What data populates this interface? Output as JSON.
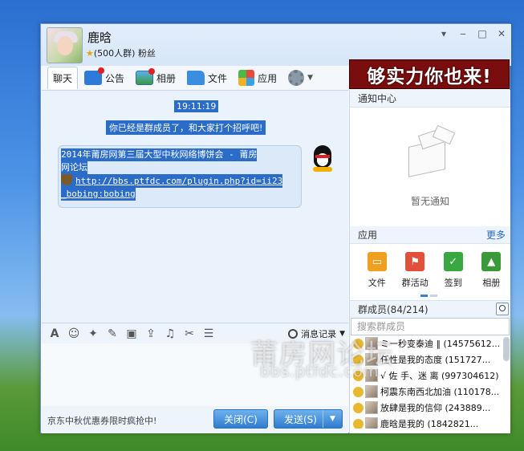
{
  "header": {
    "group_name": "鹿晗",
    "group_sub": "(500人群) 粉丝"
  },
  "tabs": [
    {
      "label": "聊天",
      "icon": "chat-icon"
    },
    {
      "label": "公告",
      "icon": "announcement-icon"
    },
    {
      "label": "相册",
      "icon": "album-icon"
    },
    {
      "label": "文件",
      "icon": "folder-icon"
    },
    {
      "label": "应用",
      "icon": "apps-icon"
    }
  ],
  "ad": {
    "text": "够实力你也来!"
  },
  "chat": {
    "time": "19:11:19",
    "system_message": "你已经是群成员了，和大家打个招呼吧!",
    "message": {
      "line1": "2014年莆房网第三届大型中秋网络博饼会 - 莆房",
      "line2": "网论坛",
      "link1": "http://bbs.ptfdc.com/plugin.php?id=ii23",
      "link2": "_bobing:bobing"
    }
  },
  "toolbar": {
    "history_label": "消息记录"
  },
  "bottom": {
    "promo": "京东中秋优惠券限时疯抢中!",
    "close_label": "关闭(C)",
    "send_label": "发送(S)"
  },
  "notifications": {
    "title": "通知中心",
    "empty": "暂无通知"
  },
  "apps": {
    "title": "应用",
    "more": "更多",
    "items": [
      {
        "label": "文件",
        "icon": "folder-icon"
      },
      {
        "label": "群活动",
        "icon": "flag-icon"
      },
      {
        "label": "签到",
        "icon": "checkin-icon"
      },
      {
        "label": "相册",
        "icon": "photo-icon"
      }
    ]
  },
  "members": {
    "title": "群成员(84/214)",
    "search_placeholder": "搜索群成员",
    "list": [
      "ミ一秒变泰迪 ‖ (14575612...",
      "任性是我的态度 (151727...",
      "√ 佐 手、迷 离 (997304612)",
      "柯震东南西北加油 (110178...",
      "放肆是我的信仰 (243889...",
      "鹿晗是我的 (1842821..."
    ]
  },
  "watermark": {
    "line1": "莆房网论坛",
    "line2": "bbs.ptfdc.com"
  }
}
